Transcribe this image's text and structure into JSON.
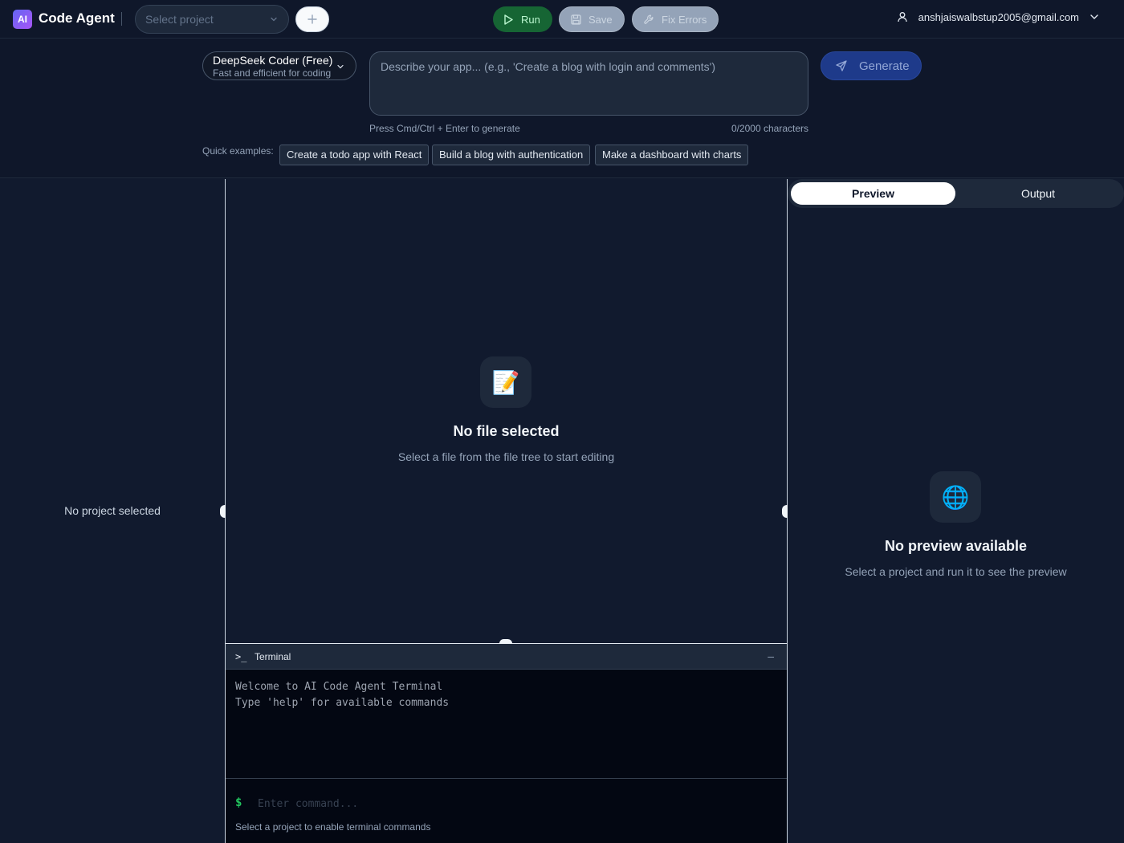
{
  "header": {
    "logo_text": "AI",
    "app_title": "Code Agent",
    "project_select_placeholder": "Select project",
    "run_label": "Run",
    "save_label": "Save",
    "fix_errors_label": "Fix Errors",
    "user_email": "anshjaiswalbstup2005@gmail.com"
  },
  "generate": {
    "model_name": "DeepSeek Coder (Free)",
    "model_desc": "Fast and efficient for coding",
    "prompt_placeholder": "Describe your app... (e.g., 'Create a blog with login and comments')",
    "generate_label": "Generate",
    "hint": "Press Cmd/Ctrl + Enter to generate",
    "char_count": "0/2000 characters",
    "examples_label": "Quick examples:",
    "examples": [
      "Create a todo app with React",
      "Build a blog with authentication",
      "Make a dashboard with charts"
    ]
  },
  "file_tree": {
    "empty_text": "No project selected"
  },
  "editor": {
    "icon": "📝",
    "empty_title": "No file selected",
    "empty_sub": "Select a file from the file tree to start editing"
  },
  "terminal": {
    "title": "Terminal",
    "lines": [
      "Welcome to AI Code Agent Terminal",
      "Type 'help' for available commands"
    ],
    "prompt_symbol": "$",
    "input_placeholder": "Enter command...",
    "note": "Select a project to enable terminal commands"
  },
  "preview": {
    "tabs": [
      "Preview",
      "Output"
    ],
    "active_tab": "Preview",
    "icon": "🌐",
    "empty_title": "No preview available",
    "empty_sub": "Select a project and run it to see the preview"
  },
  "colors": {
    "background": "#111a2e",
    "run_green": "#166534",
    "generate_blue": "#1e3a8a",
    "terminal_bg": "#030712",
    "logo_gradient_start": "#6366f1",
    "logo_gradient_end": "#a855f7"
  }
}
